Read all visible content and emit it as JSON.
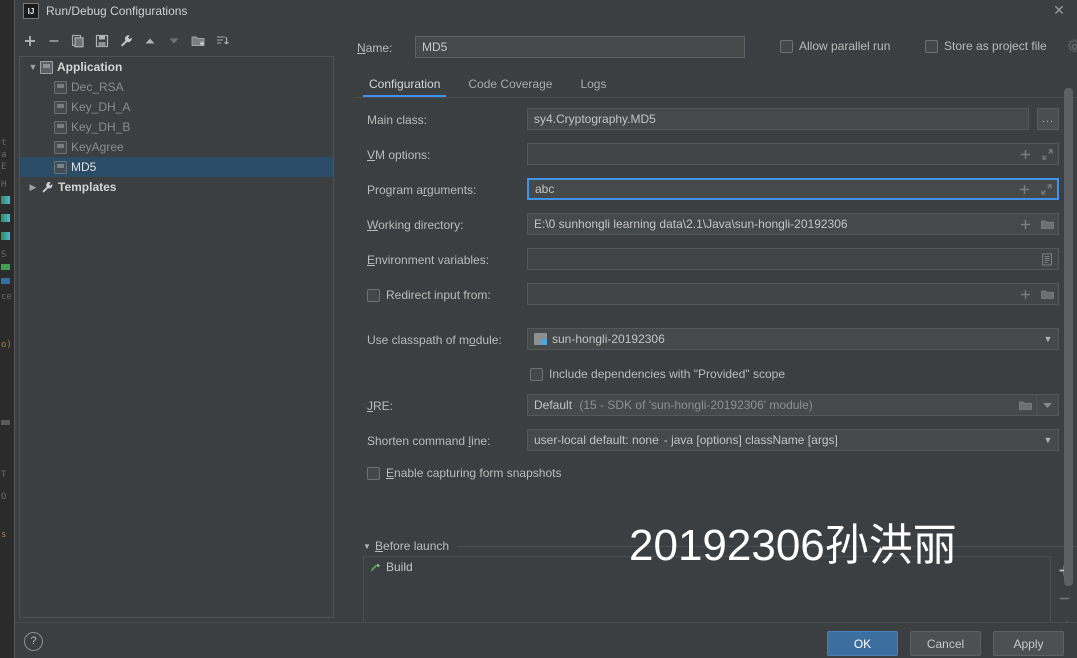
{
  "window": {
    "title": "Run/Debug Configurations",
    "app_icon": "IJ",
    "close_icon": "close-icon"
  },
  "left_panel": {
    "toolbar": [
      {
        "name": "add-configuration-button",
        "icon": "plus-icon"
      },
      {
        "name": "remove-configuration-button",
        "icon": "minus-icon"
      },
      {
        "name": "copy-configuration-button",
        "icon": "copy-icon"
      },
      {
        "name": "save-configuration-button",
        "icon": "save-icon"
      },
      {
        "name": "edit-templates-button",
        "icon": "wrench-icon"
      },
      {
        "name": "move-up-button",
        "icon": "arrow-up-icon"
      },
      {
        "name": "move-down-button",
        "icon": "arrow-down-icon"
      },
      {
        "name": "new-folder-button",
        "icon": "folder-add-icon"
      },
      {
        "name": "sort-configurations-button",
        "icon": "sort-icon"
      }
    ],
    "tree": [
      {
        "label": "Application",
        "level": 0,
        "type": "group",
        "expanded": true,
        "selected": false,
        "icon": "application-icon"
      },
      {
        "label": "Dec_RSA",
        "level": 1,
        "type": "config",
        "selected": false,
        "icon": "configuration-icon"
      },
      {
        "label": "Key_DH_A",
        "level": 1,
        "type": "config",
        "selected": false,
        "icon": "configuration-icon"
      },
      {
        "label": "Key_DH_B",
        "level": 1,
        "type": "config",
        "selected": false,
        "icon": "configuration-icon"
      },
      {
        "label": "KeyAgree",
        "level": 1,
        "type": "config",
        "selected": false,
        "icon": "configuration-icon"
      },
      {
        "label": "MD5",
        "level": 1,
        "type": "config",
        "selected": true,
        "icon": "configuration-icon"
      },
      {
        "label": "Templates",
        "level": 0,
        "type": "templates",
        "expanded": false,
        "selected": false,
        "icon": "wrench-icon"
      }
    ]
  },
  "header": {
    "name_label": "Name:",
    "name_value": "MD5",
    "allow_parallel_run_label": "Allow parallel run",
    "allow_parallel_run_checked": false,
    "store_as_project_file_label": "Store as project file",
    "store_as_project_file_checked": false,
    "gear_icon": "gear-icon"
  },
  "tabs": [
    {
      "label": "Configuration",
      "active": true
    },
    {
      "label": "Code Coverage",
      "active": false
    },
    {
      "label": "Logs",
      "active": false
    }
  ],
  "form": {
    "main_class": {
      "label": "Main class:",
      "value": "sy4.Cryptography.MD5",
      "browse_button": "..."
    },
    "vm_options": {
      "label": "VM options:",
      "value": "",
      "icons": [
        "plus-icon",
        "expand-icon"
      ]
    },
    "program_arguments": {
      "label": "Program arguments:",
      "value": "abc",
      "focused": true,
      "icons": [
        "plus-icon",
        "expand-icon"
      ]
    },
    "working_directory": {
      "label": "Working directory:",
      "value": "E:\\0 sunhongli learning data\\2.1\\Java\\sun-hongli-20192306",
      "icons": [
        "plus-icon",
        "folder-icon"
      ]
    },
    "environment_variables": {
      "label": "Environment variables:",
      "value": "",
      "icons": [
        "list-edit-icon"
      ]
    },
    "redirect_input": {
      "label": "Redirect input from:",
      "checked": false,
      "value": "",
      "icons": [
        "plus-icon",
        "folder-icon"
      ]
    },
    "use_classpath_of_module": {
      "label": "Use classpath of module:",
      "value": "sun-hongli-20192306",
      "icon": "module-icon"
    },
    "include_dependencies": {
      "label": "Include dependencies with \"Provided\" scope",
      "checked": false
    },
    "jre": {
      "label": "JRE:",
      "value": "Default",
      "value_hint": "(15 - SDK of 'sun-hongli-20192306' module)",
      "icons": [
        "folder-icon",
        "dropdown-icon"
      ]
    },
    "shorten_command_line": {
      "label": "Shorten command line:",
      "value": "user-local default: none",
      "value_hint": "- java [options] className [args]"
    },
    "enable_capturing_form_snapshots": {
      "label": "Enable capturing form snapshots",
      "checked": false
    }
  },
  "before_launch": {
    "title": "Before launch",
    "expanded": true,
    "items": [
      {
        "label": "Build",
        "icon": "build-hammer-icon"
      }
    ],
    "side_buttons": [
      {
        "name": "add-before-launch-task-button",
        "icon": "plus-icon"
      },
      {
        "name": "remove-before-launch-task-button",
        "icon": "minus-icon"
      },
      {
        "name": "edit-before-launch-task-button",
        "icon": "pencil-icon"
      }
    ]
  },
  "watermark": "20192306孙洪丽",
  "footer": {
    "help_label": "?",
    "ok_label": "OK",
    "cancel_label": "Cancel",
    "apply_label": "Apply"
  },
  "colors": {
    "background": "#3c3f41",
    "accent_blue": "#3f93e8",
    "selection_blue": "#2b4c66",
    "ok_button": "#3c6e9f",
    "field_background": "#45494a"
  }
}
